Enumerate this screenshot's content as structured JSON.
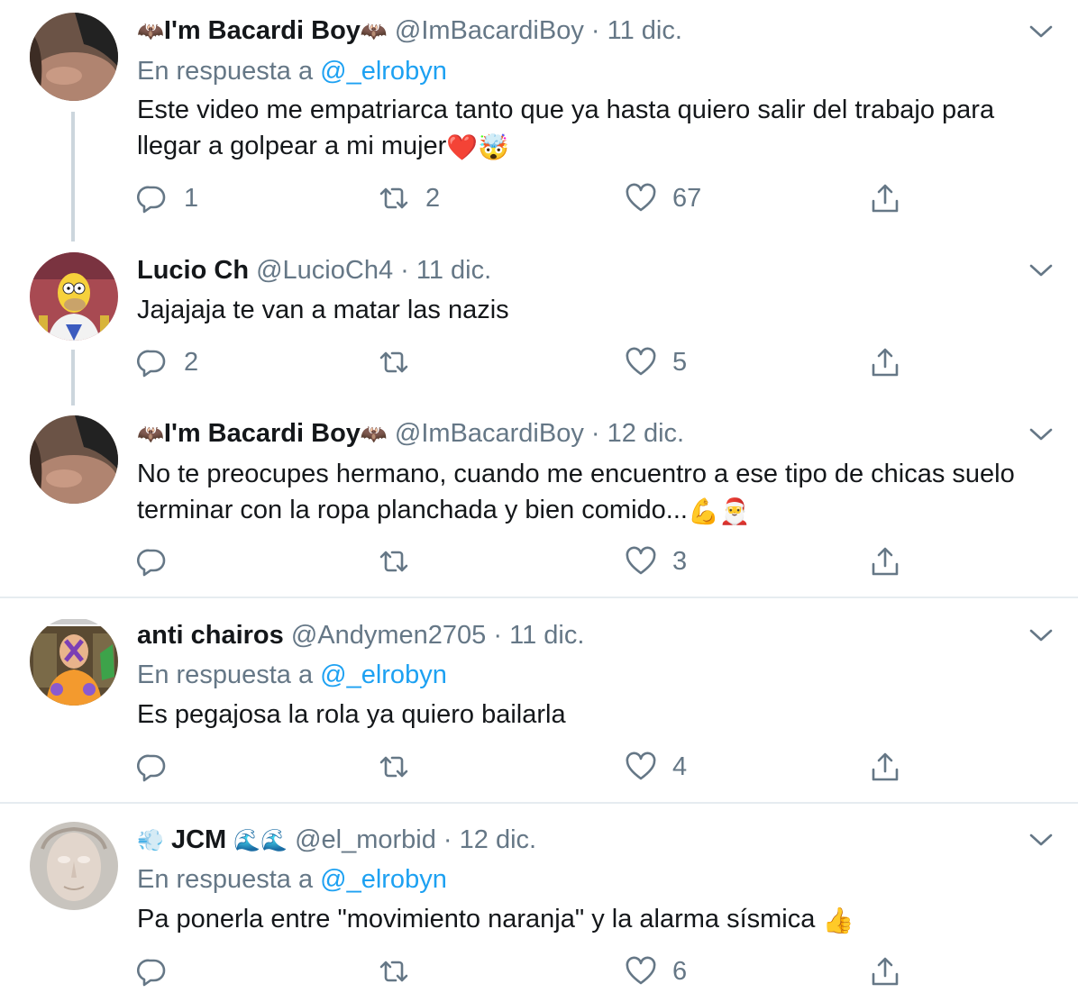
{
  "colors": {
    "text": "#14171a",
    "secondary": "#657786",
    "link": "#1da1f2",
    "thread_line": "#ccd6dd",
    "divider": "#e6ecf0"
  },
  "tweets": [
    {
      "display_name": "I'm Bacardi Boy",
      "name_prefix_emoji": "🦇",
      "name_suffix_emoji": "🦇",
      "handle": "@ImBacardiBoy",
      "separator": "·",
      "time": "11 dic.",
      "reply_label": "En respuesta a",
      "reply_mention": "@_elrobyn",
      "text": "Este video me empatriarca tanto que ya hasta quiero salir del trabajo para llegar a golpear a mi mujer",
      "text_emojis": "❤️🤯",
      "replies": "1",
      "retweets": "2",
      "likes": "67",
      "icons": [
        "reply-icon",
        "retweet-icon",
        "like-icon",
        "share-icon",
        "chevron-down-icon"
      ]
    },
    {
      "display_name": "Lucio Ch",
      "handle": "@LucioCh4",
      "separator": "·",
      "time": "11 dic.",
      "text": "Jajajaja te van a matar las nazis",
      "replies": "2",
      "retweets": "",
      "likes": "5"
    },
    {
      "display_name": "I'm Bacardi Boy",
      "name_prefix_emoji": "🦇",
      "name_suffix_emoji": "🦇",
      "handle": "@ImBacardiBoy",
      "separator": "·",
      "time": "12 dic.",
      "text": "No te preocupes hermano, cuando me encuentro a ese tipo de chicas suelo terminar con la ropa planchada y bien comido...",
      "text_emojis": "💪🎅",
      "replies": "",
      "retweets": "",
      "likes": "3"
    },
    {
      "display_name": "anti chairos",
      "handle": "@Andymen2705",
      "separator": "·",
      "time": "11 dic.",
      "reply_label": "En respuesta a",
      "reply_mention": "@_elrobyn",
      "text": "Es pegajosa la rola ya quiero bailarla",
      "replies": "",
      "retweets": "",
      "likes": "4"
    },
    {
      "display_name": "JCM",
      "name_prefix_emoji": "💨",
      "name_suffix_emoji": "🌊🌊",
      "handle": "@el_morbid",
      "separator": "·",
      "time": "12 dic.",
      "reply_label": "En respuesta a",
      "reply_mention": "@_elrobyn",
      "text": "Pa ponerla entre \"movimiento naranja\" y la alarma sísmica",
      "text_emojis": "👍",
      "replies": "",
      "retweets": "",
      "likes": "6"
    }
  ]
}
